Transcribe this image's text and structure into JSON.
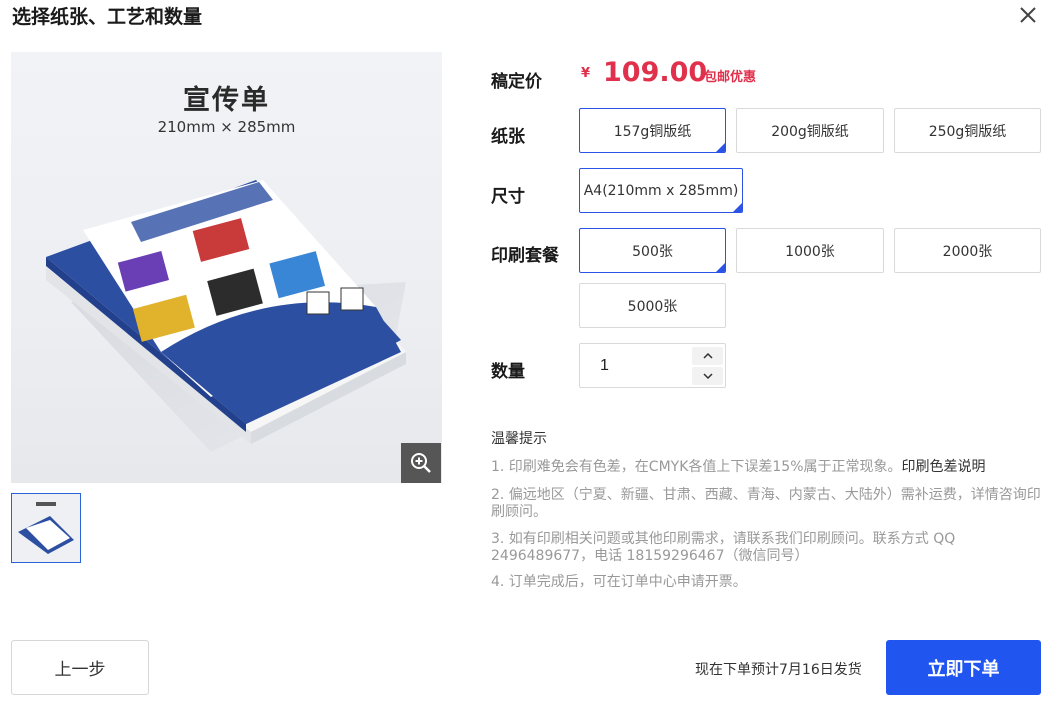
{
  "dialog": {
    "title": "选择纸张、工艺和数量"
  },
  "preview": {
    "title": "宣传单",
    "subtitle": "210mm × 285mm"
  },
  "price": {
    "label": "稿定价",
    "currency": "¥",
    "value": "109.00",
    "note": "包邮优惠"
  },
  "paper": {
    "label": "纸张",
    "options": [
      "157g铜版纸",
      "200g铜版纸",
      "250g铜版纸"
    ],
    "selected": "157g铜版纸"
  },
  "size": {
    "label": "尺寸",
    "options": [
      "A4(210mm x 285mm)"
    ],
    "selected": "A4(210mm x 285mm)"
  },
  "package": {
    "label": "印刷套餐",
    "options": [
      "500张",
      "1000张",
      "2000张",
      "5000张"
    ],
    "selected": "500张"
  },
  "quantity": {
    "label": "数量",
    "value": "1"
  },
  "tips": {
    "title": "温馨提示",
    "items": [
      "1. 印刷难免会有色差，在CMYK各值上下误差15%属于正常现象。",
      "2. 偏远地区（宁夏、新疆、甘肃、西藏、青海、内蒙古、大陆外）需补运费，详情咨询印刷顾问。",
      "3. 如有印刷相关问题或其他印刷需求，请联系我们印刷顾问。联系方式 QQ 2496489677，电话 18159296467（微信同号）",
      "4. 订单完成后，可在订单中心申请开票。"
    ],
    "link": "印刷色差说明"
  },
  "footer": {
    "back_label": "上一步",
    "ship_note": "现在下单预计7月16日发货",
    "order_label": "立即下单"
  },
  "colors": {
    "accent": "#2155f0",
    "price": "#e0304c",
    "selected_border": "#2b54e6"
  },
  "icons": {
    "close": "close-icon",
    "zoom": "zoom-in-icon",
    "stepper_up": "chevron-up-icon",
    "stepper_down": "chevron-down-icon"
  }
}
